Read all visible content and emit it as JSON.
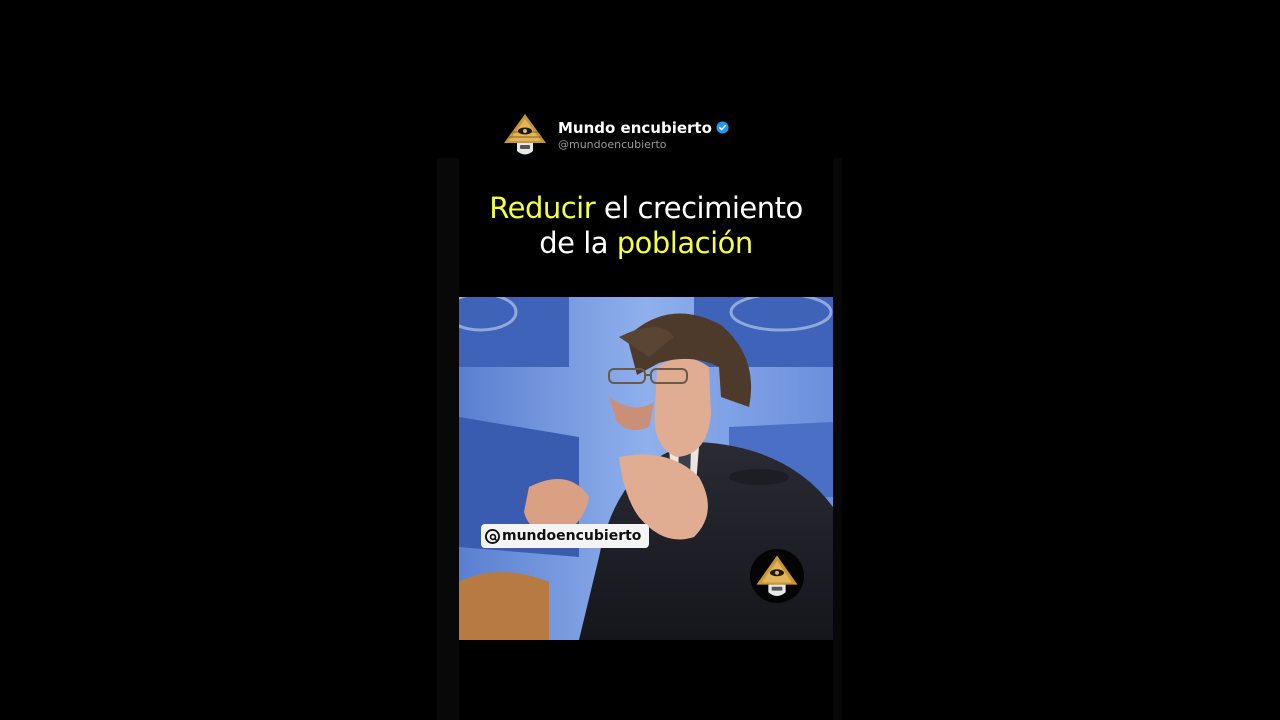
{
  "account": {
    "name": "Mundo encubierto",
    "handle": "@mundoencubierto",
    "avatar_icon": "illuminati-pyramid-icon",
    "verified_icon": "verified-badge-icon"
  },
  "caption": {
    "line1_highlight": "Reducir",
    "line1_rest": " el crecimiento",
    "line2_start": "de la ",
    "line2_highlight": "población"
  },
  "video": {
    "watermark_text": "mundoencubierto",
    "watermark_icon": "threads-logo-icon",
    "overlay_logo_icon": "illuminati-pyramid-icon"
  },
  "colors": {
    "highlight": "#f4ff3d",
    "text": "#ffffff",
    "background": "#000000",
    "verified": "#1d9bf0"
  }
}
